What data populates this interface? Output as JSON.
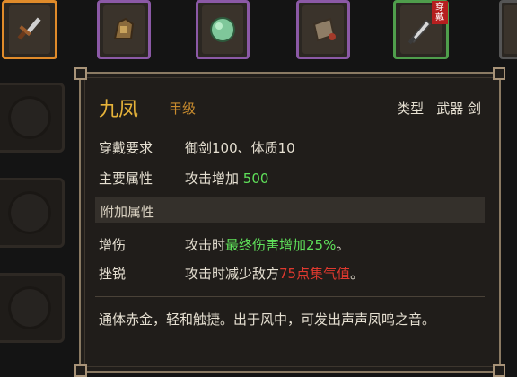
{
  "inventory": {
    "slots": [
      {
        "icon": "sword-icon",
        "rarity_color": "#e08b2a"
      },
      {
        "icon": "gauntlet-icon",
        "rarity_color": "#8b59a6"
      },
      {
        "icon": "jade-orb-icon",
        "rarity_color": "#8b59a6"
      },
      {
        "icon": "pouch-icon",
        "rarity_color": "#8b59a6"
      },
      {
        "icon": "sword-icon",
        "rarity_color": "#4f9e4c",
        "badge": "穿戴"
      },
      {
        "icon": "item-icon",
        "rarity_color": "#555555"
      }
    ]
  },
  "tooltip": {
    "item_name": "九凤",
    "grade": "甲级",
    "type_label": "类型",
    "type_category": "武器",
    "type_sub": "剑",
    "requirement_label": "穿戴要求",
    "requirement_value": "御剑100、体质10",
    "main_attr_label": "主要属性",
    "main_attr_text": "攻击增加",
    "main_attr_value": "500",
    "extra_section_label": "附加属性",
    "extra": [
      {
        "name": "增伤",
        "prefix": "攻击时",
        "highlight": "最终伤害增加25%",
        "suffix": "。",
        "highlight_color": "#5fe05a"
      },
      {
        "name": "挫锐",
        "prefix": "攻击时减少敌方",
        "highlight": "75点集气值",
        "suffix": "。",
        "highlight_color": "#e0392f"
      }
    ],
    "description": "通体赤金，轻和触捷。出于风中，可发出声声凤鸣之音。"
  },
  "colors": {
    "name": "#e6b33a",
    "grade": "#c98c2e",
    "border": "#8a7a63",
    "positive": "#5fe05a",
    "negative": "#e0392f"
  }
}
